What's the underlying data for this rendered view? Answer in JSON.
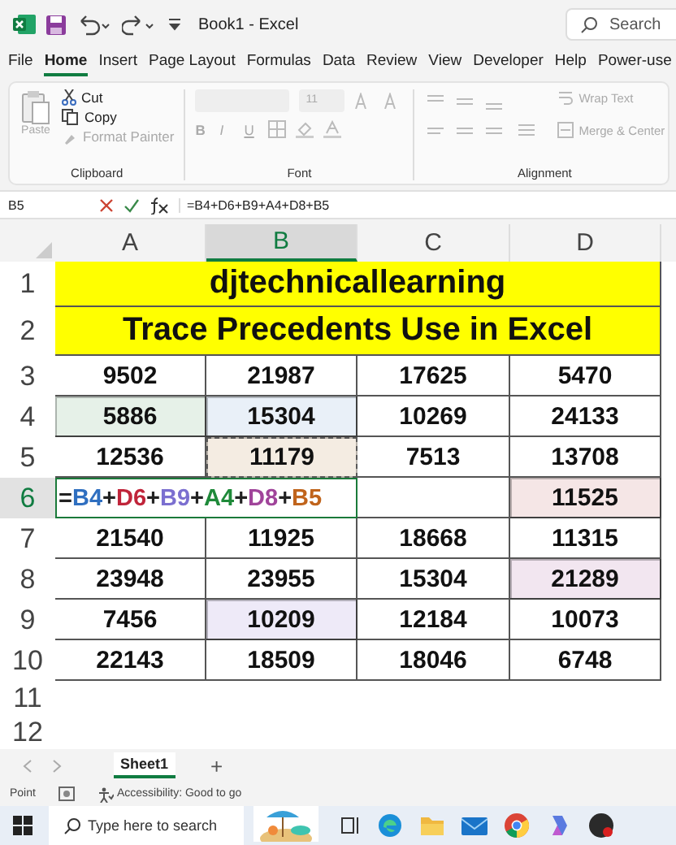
{
  "window": {
    "title": "Book1 - Excel",
    "search": {
      "placeholder": "Search"
    }
  },
  "menu": [
    {
      "label": "File",
      "selected": false
    },
    {
      "label": "Home",
      "selected": true
    },
    {
      "label": "Insert",
      "selected": false
    },
    {
      "label": "Page Layout",
      "selected": false
    },
    {
      "label": "Formulas",
      "selected": false
    },
    {
      "label": "Data",
      "selected": false
    },
    {
      "label": "Review",
      "selected": false
    },
    {
      "label": "View",
      "selected": false
    },
    {
      "label": "Developer",
      "selected": false
    },
    {
      "label": "Help",
      "selected": false
    },
    {
      "label": "Power-use",
      "selected": false
    }
  ],
  "ribbon": {
    "clipboard": {
      "title": "Clipboard",
      "paste": {
        "label": "Paste",
        "disabled": true
      },
      "cut": {
        "label": "Cut",
        "disabled": false
      },
      "copy": {
        "label": "Copy",
        "disabled": false
      },
      "format_painter": {
        "label": "Format Painter",
        "disabled": true
      }
    },
    "font": {
      "title": "Font",
      "size": "11",
      "bold": "B",
      "italic": "I",
      "underline": "U"
    },
    "alignment": {
      "title": "Alignment",
      "wrap_text": {
        "label": "Wrap Text",
        "disabled": true
      },
      "merge_center": {
        "label": "Merge & Center",
        "disabled": true
      }
    }
  },
  "formula_bar": {
    "name_box": "B5",
    "formula": "=B4+D6+B9+A4+D8+B5"
  },
  "columns": [
    {
      "label": "A",
      "selected": false
    },
    {
      "label": "B",
      "selected": true
    },
    {
      "label": "C",
      "selected": false
    },
    {
      "label": "D",
      "selected": false
    }
  ],
  "rows": [
    {
      "label": "1",
      "selected": false,
      "cells": [
        {
          "kind": "title",
          "text": "djtechnicallearning"
        }
      ]
    },
    {
      "label": "2",
      "selected": false,
      "cells": [
        {
          "kind": "title",
          "text": "Trace Precedents Use in Excel"
        }
      ]
    },
    {
      "label": "3",
      "selected": false,
      "cells": [
        {
          "kind": "number",
          "text": "9502"
        },
        {
          "kind": "number",
          "text": "21987"
        },
        {
          "kind": "number",
          "text": "17625"
        },
        {
          "kind": "number",
          "text": "5470"
        }
      ]
    },
    {
      "label": "4",
      "selected": false,
      "cells": [
        {
          "kind": "number",
          "text": "5886",
          "color": "#e6f1e8"
        },
        {
          "kind": "number",
          "text": "15304",
          "color": "#e9f0f8"
        },
        {
          "kind": "number",
          "text": "10269"
        },
        {
          "kind": "number",
          "text": "24133"
        }
      ]
    },
    {
      "label": "5",
      "selected": false,
      "cells": [
        {
          "kind": "number",
          "text": "12536"
        },
        {
          "kind": "number",
          "text": "11179",
          "color": "#f4ece2",
          "marquee": true
        },
        {
          "kind": "number",
          "text": "7513"
        },
        {
          "kind": "number",
          "text": "13708"
        }
      ]
    },
    {
      "label": "6",
      "selected": true,
      "cells": [
        {
          "kind": "formula",
          "parts": [
            {
              "text": "=",
              "color": "#222222"
            },
            {
              "text": "B4",
              "color": "#2f6fc0"
            },
            {
              "text": "+",
              "color": "#222222"
            },
            {
              "text": "D6",
              "color": "#c0243a"
            },
            {
              "text": "+",
              "color": "#222222"
            },
            {
              "text": "B9",
              "color": "#7b6fd0"
            },
            {
              "text": "+",
              "color": "#222222"
            },
            {
              "text": "A4",
              "color": "#1f8a3a"
            },
            {
              "text": "+",
              "color": "#222222"
            },
            {
              "text": "D8",
              "color": "#a0449a"
            },
            {
              "text": "+",
              "color": "#222222"
            },
            {
              "text": "B5",
              "color": "#c0641c"
            }
          ]
        },
        {
          "kind": "empty"
        },
        {
          "kind": "number",
          "text": "11525",
          "color": "#f5e6e6"
        }
      ]
    },
    {
      "label": "7",
      "selected": false,
      "cells": [
        {
          "kind": "number",
          "text": "21540"
        },
        {
          "kind": "number",
          "text": "11925"
        },
        {
          "kind": "number",
          "text": "18668"
        },
        {
          "kind": "number",
          "text": "11315"
        }
      ]
    },
    {
      "label": "8",
      "selected": false,
      "cells": [
        {
          "kind": "number",
          "text": "23948"
        },
        {
          "kind": "number",
          "text": "23955"
        },
        {
          "kind": "number",
          "text": "15304"
        },
        {
          "kind": "number",
          "text": "21289",
          "color": "#f2e6f0"
        }
      ]
    },
    {
      "label": "9",
      "selected": false,
      "cells": [
        {
          "kind": "number",
          "text": "7456"
        },
        {
          "kind": "number",
          "text": "10209",
          "color": "#eeeaf8"
        },
        {
          "kind": "number",
          "text": "12184"
        },
        {
          "kind": "number",
          "text": "10073"
        }
      ]
    },
    {
      "label": "10",
      "selected": false,
      "cells": [
        {
          "kind": "number",
          "text": "22143"
        },
        {
          "kind": "number",
          "text": "18509"
        },
        {
          "kind": "number",
          "text": "18046"
        },
        {
          "kind": "number",
          "text": "6748"
        }
      ]
    },
    {
      "label": "11",
      "selected": false,
      "cells": []
    },
    {
      "label": "12",
      "selected": false,
      "cells": []
    }
  ],
  "sheets": [
    {
      "label": "Sheet1",
      "selected": true
    }
  ],
  "add_sheet": "+",
  "status_bar": {
    "mode": "Point",
    "accessibility": "Accessibility: Good to go"
  },
  "taskbar": {
    "search": {
      "placeholder": "Type here to search"
    }
  }
}
